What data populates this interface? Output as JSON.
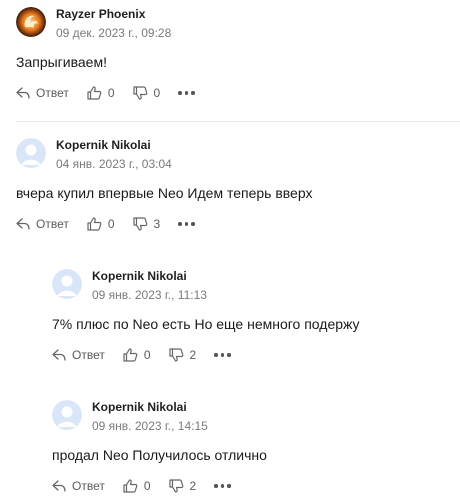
{
  "comments": [
    {
      "author": "Rayzer Phoenix",
      "date": "09 дек. 2023 г., 09:28",
      "text": "Запрыгиваем!",
      "reply_label": "Ответ",
      "likes": "0",
      "dislikes": "0",
      "avatar": "phoenix-logo"
    },
    {
      "author": "Kopernik Nikolai",
      "date": "04 янв. 2023 г., 03:04",
      "text": "вчера купил впервые  Neo  Идем теперь вверх",
      "reply_label": "Ответ",
      "likes": "0",
      "dislikes": "3",
      "avatar": "default-user"
    },
    {
      "author": "Kopernik Nikolai",
      "date": "09 янв. 2023 г., 11:13",
      "text": "7% плюс по Neo есть Но еще немного подержу",
      "reply_label": "Ответ",
      "likes": "0",
      "dislikes": "2",
      "avatar": "default-user"
    },
    {
      "author": "Kopernik Nikolai",
      "date": "09 янв. 2023 г., 14:15",
      "text": "продал Neo Получилось отлично",
      "reply_label": "Ответ",
      "likes": "0",
      "dislikes": "2",
      "avatar": "default-user"
    }
  ],
  "colors": {
    "avatar_bg": "#d9e6f7",
    "avatar_figure": "#ffffff",
    "phoenix_orange": "#e8771c",
    "phoenix_dark": "#3a1606",
    "muted_text": "#7a7a7a"
  }
}
